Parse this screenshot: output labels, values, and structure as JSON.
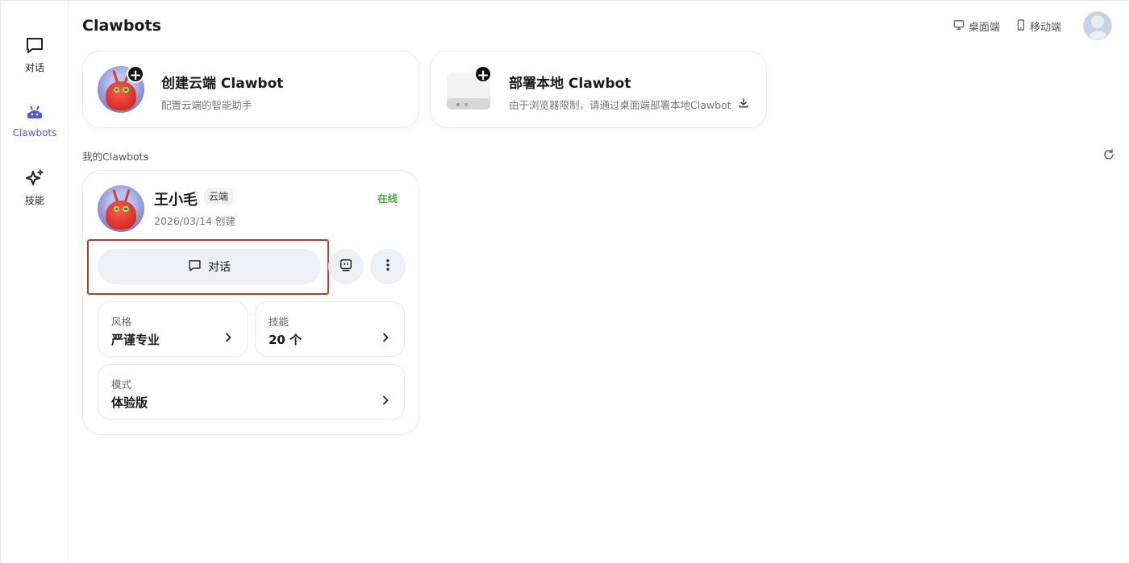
{
  "sidebar": {
    "items": [
      {
        "label": "对话",
        "icon": "chat-icon",
        "active": false
      },
      {
        "label": "Clawbots",
        "icon": "android-bot-icon",
        "active": true
      },
      {
        "label": "技能",
        "icon": "sparkle-icon",
        "active": false
      }
    ]
  },
  "header": {
    "title": "Clawbots",
    "desktop_label": "桌面端",
    "mobile_label": "移动端"
  },
  "create_cards": [
    {
      "title": "创建云端 Clawbot",
      "subtitle": "配置云端的智能助手"
    },
    {
      "title": "部署本地 Clawbot",
      "subtitle": "由于浏览器限制，请通过桌面端部署本地Clawbot"
    }
  ],
  "my_bots": {
    "section_label": "我的Clawbots",
    "bots": [
      {
        "name": "王小毛",
        "tag": "云端",
        "created": "2026/03/14 创建",
        "status": "在线",
        "chat_button": "对话",
        "tiles": [
          {
            "label": "风格",
            "value": "严谨专业"
          },
          {
            "label": "技能",
            "value": "20 个"
          },
          {
            "label": "模式",
            "value": "体验版"
          }
        ]
      }
    ]
  },
  "colors": {
    "accent": "#4b5ad1",
    "online": "#46b33d",
    "highlight": "#c0392b",
    "button_bg": "#eef0f8"
  }
}
